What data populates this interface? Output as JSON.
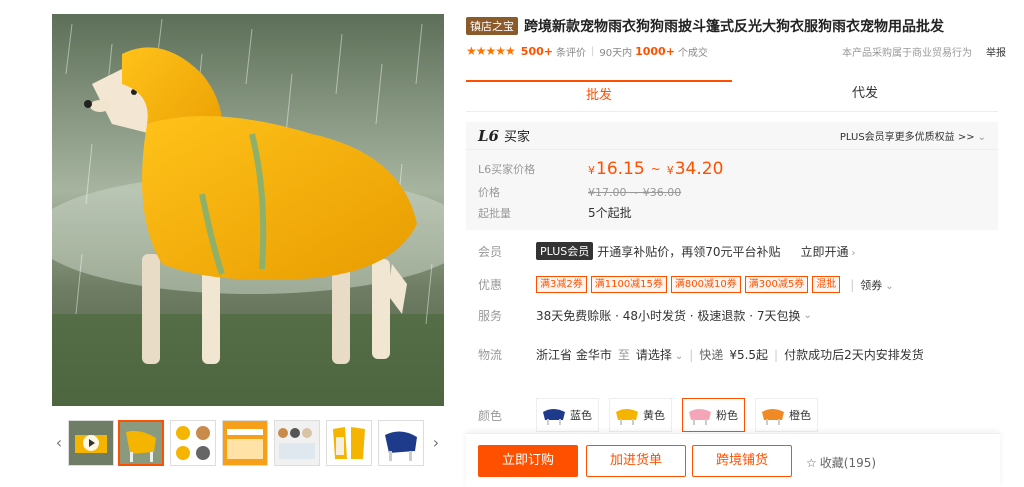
{
  "gallery": {
    "prev_arrow": "‹",
    "next_arrow": "›",
    "thumbnails": [
      "video",
      "yellow-coat",
      "detail-sheet",
      "size-chart",
      "multi-dogs",
      "coat-front-back",
      "blue-coat"
    ]
  },
  "product": {
    "shop_badge": "镇店之宝",
    "title": "跨境新款宠物雨衣狗狗雨披斗篷式反光大狗衣服狗雨衣宠物用品批发",
    "stars": "★★★★★",
    "review_count": "500+",
    "review_label": "条评价",
    "sold_period": "90天内",
    "sold_count": "1000+",
    "sold_label": "个成交",
    "trade_note": "本产品采购属于商业贸易行为",
    "report": "举报"
  },
  "tabs": [
    {
      "label": "批发",
      "active": true
    },
    {
      "label": "代发",
      "active": false
    }
  ],
  "price_box": {
    "level": "L6",
    "level_name": "买家",
    "plus_note": "PLUS会员享更多优质权益 >>",
    "buyer_price_label": "L6买家价格",
    "currency": "¥",
    "price_low": "16.15",
    "tilde": "~",
    "price_high": "34.20",
    "orig_label": "价格",
    "orig_price": "¥17.00 ~ ¥36.00",
    "moq_label": "起批量",
    "moq_value": "5个起批"
  },
  "member": {
    "label": "会员",
    "badge": "PLUS会员",
    "text": "开通享补贴价，再领70元平台补贴",
    "link": "立即开通"
  },
  "promo": {
    "label": "优惠",
    "coupons": [
      "满3减2券",
      "满1100减15券",
      "满800减10券",
      "满300减5券",
      "混批"
    ],
    "more": "领券"
  },
  "service": {
    "label": "服务",
    "text": "38天免费赊账 · 48小时发货 · 极速退款 · 7天包换"
  },
  "logistics": {
    "label": "物流",
    "from": "浙江省 金华市",
    "to_word": "至",
    "select": "请选择",
    "express": "快递",
    "fee": "¥5.5起",
    "ship_note": "付款成功后2天内安排发货"
  },
  "colors": {
    "label": "颜色",
    "options": [
      {
        "name": "蓝色",
        "hex": "#1e3a8a"
      },
      {
        "name": "黄色",
        "hex": "#f5b400"
      },
      {
        "name": "粉色",
        "hex": "#f4a6b8"
      },
      {
        "name": "橙色",
        "hex": "#f08a24"
      }
    ]
  },
  "actions": {
    "buy": "立即订购",
    "add_cart": "加进货单",
    "cross_border": "跨境铺货",
    "favorite": "收藏(195)"
  },
  "theme": {
    "accent": "#ff5000",
    "coat_yellow": "#f5b400"
  }
}
